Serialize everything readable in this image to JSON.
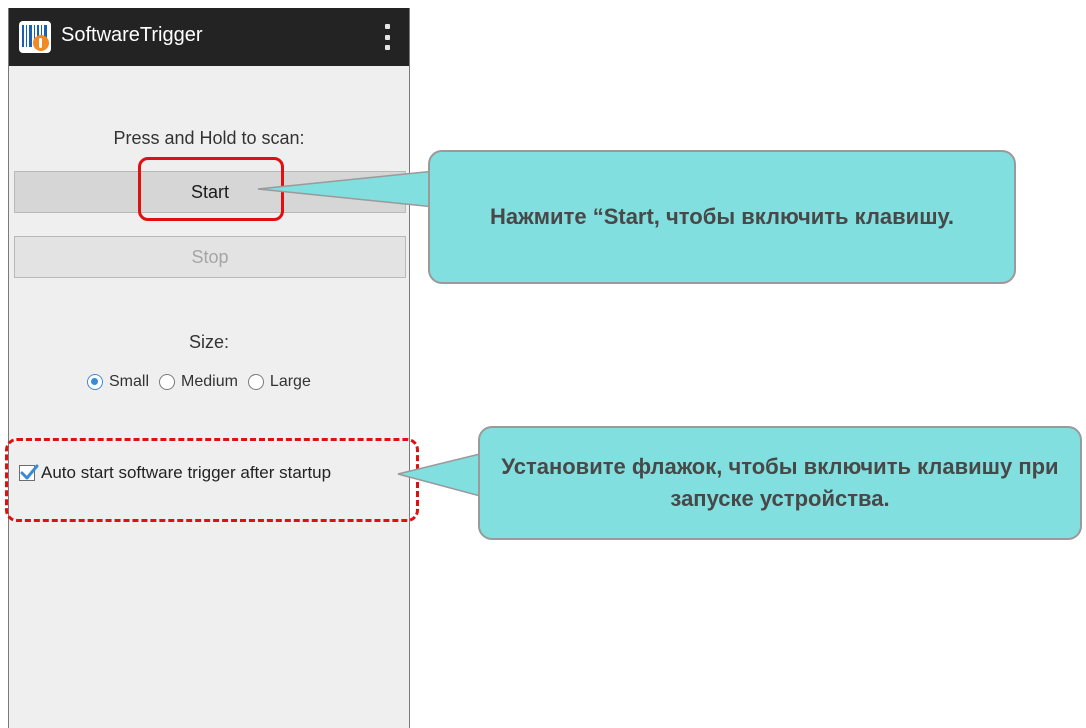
{
  "app": {
    "title": "SoftwareTrigger",
    "icon": "barcode-scan-app-icon",
    "menu_icon": "overflow-menu-icon"
  },
  "main": {
    "prompt": "Press and Hold to scan:",
    "start_label": "Start",
    "stop_label": "Stop",
    "size_label": "Size:",
    "size_options": [
      {
        "label": "Small",
        "checked": true
      },
      {
        "label": "Medium",
        "checked": false
      },
      {
        "label": "Large",
        "checked": false
      }
    ],
    "auto_start_label": "Auto start software trigger after startup",
    "auto_start_checked": true
  },
  "callouts": {
    "start_note": "Нажмите “Start, чтобы включить клавишу.",
    "autostart_note": "Установите флажок, чтобы включить клавишу при запуске устройства."
  },
  "colors": {
    "accent": "#3a8bd4",
    "highlight": "#e01010",
    "callout_bg": "#82dfe0"
  }
}
